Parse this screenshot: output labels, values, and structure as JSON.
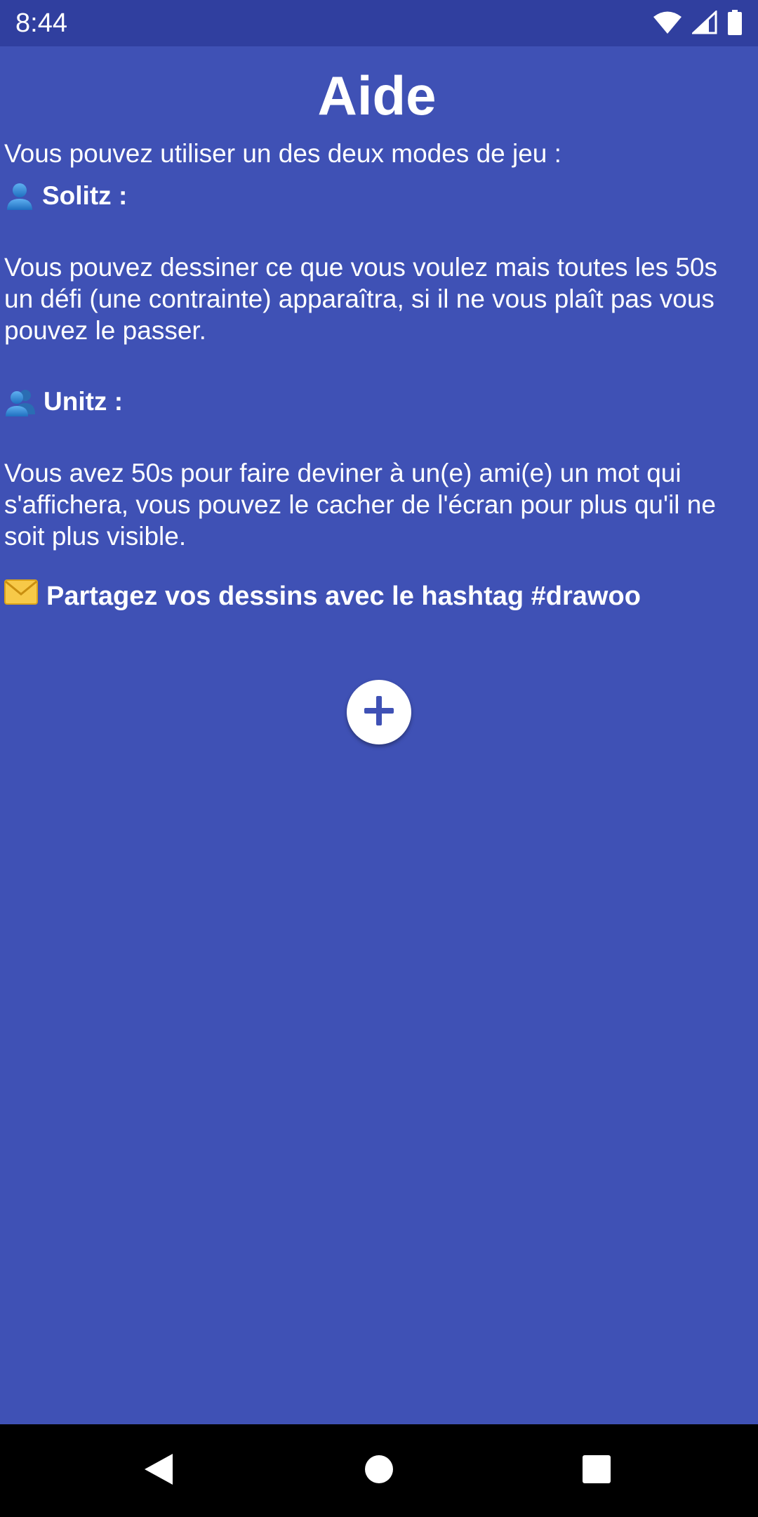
{
  "status_bar": {
    "time": "8:44",
    "icons": [
      "wifi-icon",
      "signal-icon",
      "battery-icon"
    ]
  },
  "page": {
    "title": "Aide",
    "intro": "Vous pouvez utiliser un des deux modes de jeu :",
    "modes": [
      {
        "icon": "single-user-icon",
        "heading": "Solitz :",
        "description": "Vous pouvez dessiner ce que vous voulez mais toutes les 50s un défi (une contrainte) apparaîtra, si il ne vous plaît pas vous pouvez le passer."
      },
      {
        "icon": "two-users-icon",
        "heading": "Unitz :",
        "description": "Vous avez 50s pour faire deviner à un(e) ami(e) un mot qui s'affichera, vous pouvez le cacher de l'écran pour plus qu'il ne soit plus visible."
      }
    ],
    "share": {
      "icon": "envelope-icon",
      "text": "Partagez vos dessins avec le hashtag #drawoo"
    },
    "add_button_icon": "plus-icon"
  },
  "nav_bar": {
    "buttons": [
      "back-icon",
      "home-icon",
      "recents-icon"
    ]
  },
  "colors": {
    "background": "#3f51b5",
    "status_bar": "#303f9f",
    "text": "#ffffff",
    "nav_bar": "#000000"
  }
}
